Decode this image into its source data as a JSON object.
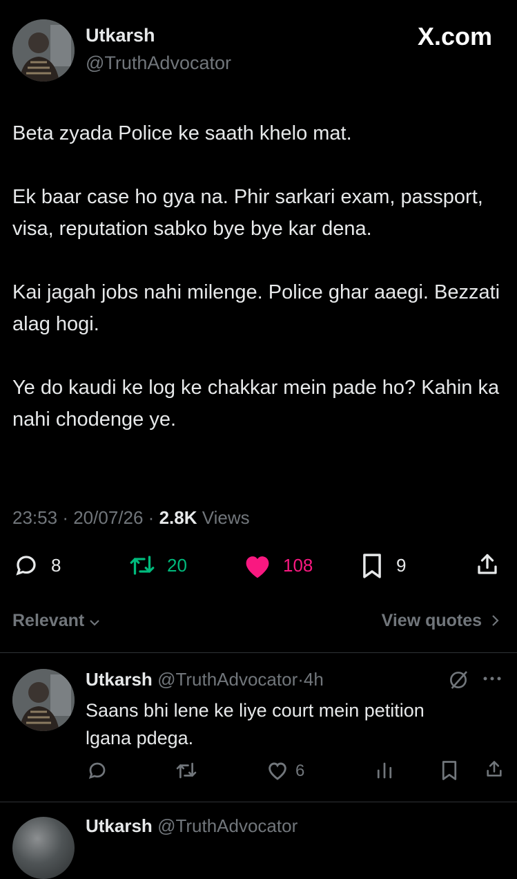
{
  "tweet": {
    "author_name": "Utkarsh",
    "author_handle": "@TruthAdvocator",
    "site_label": "X.com",
    "paragraphs": [
      "Beta zyada Police ke saath khelo mat.",
      "Ek baar case ho gya na. Phir sarkari exam, passport, visa, reputation sabko bye bye kar dena.",
      "Kai jagah jobs nahi milenge. Police ghar aaegi. Bezzati alag hogi.",
      "Ye do kaudi ke log ke chakkar mein pade ho? Kahin ka nahi chodenge ye."
    ],
    "time": "23:53",
    "date": "20/07/26",
    "separator": "·",
    "views_count": "2.8K",
    "views_label": "Views",
    "replies": "8",
    "reposts": "20",
    "likes": "108",
    "bookmarks": "9",
    "colors": {
      "repost": "#00ba7c",
      "like": "#f91880"
    }
  },
  "filter": {
    "sort_label": "Relevant",
    "view_quotes_label": "View quotes"
  },
  "reply": {
    "author_name": "Utkarsh",
    "author_handle": "@TruthAdvocator",
    "separator": "·",
    "time_ago": "4h",
    "text": "Saans bhi lene ke liye court mein petition lgana pdega.",
    "likes": "6"
  },
  "next_reply": {
    "author_name": "Utkarsh",
    "author_handle": "@TruthAdvocator"
  }
}
